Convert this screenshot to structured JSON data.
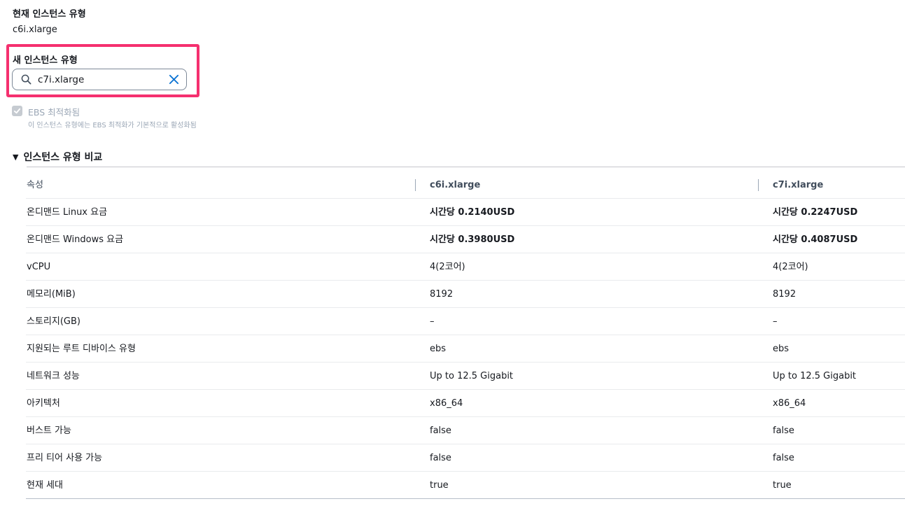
{
  "current": {
    "label": "현재 인스턴스 유형",
    "value": "c6i.xlarge"
  },
  "new_type": {
    "label": "새 인스턴스 유형",
    "value": "c7i.xlarge"
  },
  "ebs": {
    "label": "EBS 최적화됨",
    "description": "이 인스턴스 유형에는 EBS 최적화가 기본적으로 활성화됨",
    "checked": true
  },
  "comparison": {
    "title": "인스턴스 유형 비교",
    "headers": [
      "속성",
      "c6i.xlarge",
      "c7i.xlarge"
    ],
    "rows": [
      {
        "attr": "온디맨드 Linux 요금",
        "a": "시간당 0.2140USD",
        "b": "시간당 0.2247USD"
      },
      {
        "attr": "온디맨드 Windows 요금",
        "a": "시간당 0.3980USD",
        "b": "시간당 0.4087USD"
      },
      {
        "attr": "vCPU",
        "a": "4(2코어)",
        "b": "4(2코어)"
      },
      {
        "attr": "메모리(MiB)",
        "a": "8192",
        "b": "8192"
      },
      {
        "attr": "스토리지(GB)",
        "a": "–",
        "b": "–"
      },
      {
        "attr": "지원되는 루트 디바이스 유형",
        "a": "ebs",
        "b": "ebs"
      },
      {
        "attr": "네트워크 성능",
        "a": "Up to 12.5 Gigabit",
        "b": "Up to 12.5 Gigabit"
      },
      {
        "attr": "아키텍처",
        "a": "x86_64",
        "b": "x86_64"
      },
      {
        "attr": "버스트 가능",
        "a": "false",
        "b": "false"
      },
      {
        "attr": "프리 티어 사용 가능",
        "a": "false",
        "b": "false"
      },
      {
        "attr": "현재 세대",
        "a": "true",
        "b": "true"
      }
    ]
  },
  "colors": {
    "highlight": "#f5306f",
    "link_blue": "#0972d3",
    "text": "#16191f",
    "disabled": "#9ba7b6"
  },
  "icons": {
    "search": "search-icon",
    "clear": "close-icon",
    "caret": "caret-down-icon",
    "check": "checkmark-icon"
  }
}
